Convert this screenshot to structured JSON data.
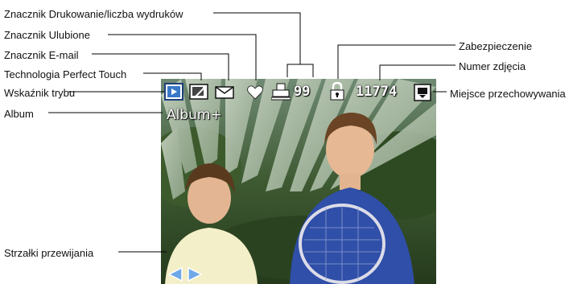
{
  "labels": {
    "printing": "Znacznik Drukowanie/liczba wydruków",
    "favorite": "Znacznik Ulubione",
    "email": "Znacznik E-mail",
    "perfect_touch": "Technologia Perfect Touch",
    "mode": "Wskaźnik trybu",
    "album": "Album",
    "scroll": "Strzałki przewijania",
    "protect": "Zabezpieczenie",
    "picture_number": "Numer zdjęcia",
    "storage": "Miejsce przechowywania"
  },
  "screen": {
    "print_count": "99",
    "picture_number": "11774",
    "album_name": "Album+"
  },
  "icons": {
    "mode": "review-mode-icon",
    "perfect_touch": "perfect-touch-icon",
    "email": "email-envelope-icon",
    "favorite": "heart-icon",
    "print": "printer-icon",
    "protect": "padlock-icon",
    "storage": "memory-card-icon",
    "scroll_left": "left-arrow-icon",
    "scroll_right": "right-arrow-icon"
  },
  "colors": {
    "scroll_arrow": "#6fa8e8",
    "mode_icon": "#3a78c8",
    "overlay_icon": "#ffffff"
  }
}
